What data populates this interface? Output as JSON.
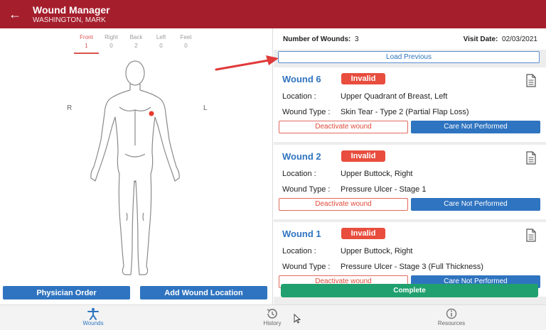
{
  "header": {
    "back_icon": "arrow-left-icon",
    "title": "Wound Manager",
    "patient": "WASHINGTON, MARK"
  },
  "view_tabs": [
    {
      "label": "Front",
      "count": "1",
      "active": true
    },
    {
      "label": "Right",
      "count": "0",
      "active": false
    },
    {
      "label": "Back",
      "count": "2",
      "active": false
    },
    {
      "label": "Left",
      "count": "0",
      "active": false
    },
    {
      "label": "Feet",
      "count": "0",
      "active": false
    }
  ],
  "body_map": {
    "right_label": "R",
    "left_label": "L",
    "marker_color": "#e8382b"
  },
  "left_buttons": {
    "physician_order": "Physician Order",
    "add_wound_location": "Add Wound Location"
  },
  "summary": {
    "wounds_label": "Number of Wounds:",
    "wounds_count": "3",
    "visit_label": "Visit Date:",
    "visit_date": "02/03/2021"
  },
  "load_previous": "Load Previous",
  "wounds": [
    {
      "title": "Wound 6",
      "status": "Invalid",
      "location_label": "Location :",
      "location": "Upper Quadrant of Breast, Left",
      "type_label": "Wound Type :",
      "type": "Skin Tear - Type 2 (Partial Flap Loss)",
      "deactivate": "Deactivate wound",
      "care": "Care Not Performed"
    },
    {
      "title": "Wound 2",
      "status": "Invalid",
      "location_label": "Location :",
      "location": "Upper Buttock, Right",
      "type_label": "Wound Type :",
      "type": "Pressure Ulcer - Stage 1",
      "deactivate": "Deactivate wound",
      "care": "Care Not Performed"
    },
    {
      "title": "Wound 1",
      "status": "Invalid",
      "location_label": "Location :",
      "location": "Upper Buttock, Right",
      "type_label": "Wound Type :",
      "type": "Pressure Ulcer - Stage 3 (Full Thickness)",
      "deactivate": "Deactivate wound",
      "care": "Care Not Performed"
    }
  ],
  "complete": "Complete",
  "bottom_nav": [
    {
      "label": "Wounds",
      "icon": "accessibility-icon",
      "active": true
    },
    {
      "label": "History",
      "icon": "history-icon",
      "active": false
    },
    {
      "label": "Resources",
      "icon": "info-icon",
      "active": false
    }
  ],
  "colors": {
    "header": "#a51e2c",
    "primary": "#2f74c0",
    "invalid": "#e84d3d",
    "complete": "#1fa06e"
  }
}
